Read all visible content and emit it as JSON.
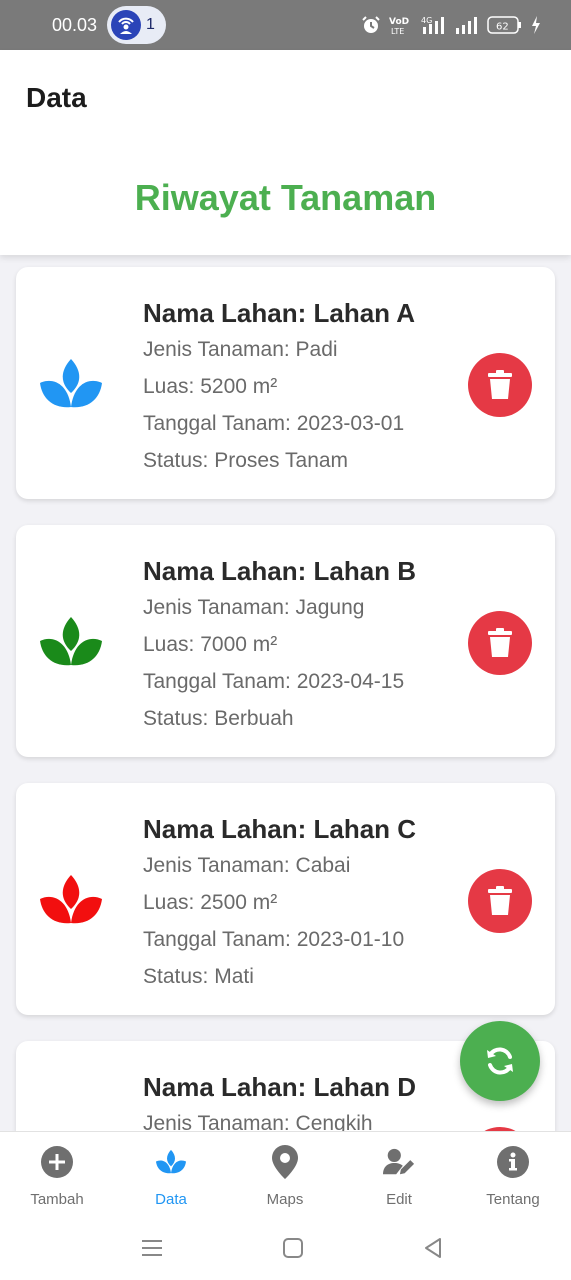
{
  "status_bar": {
    "time": "00.03",
    "notification_count": "1",
    "network_label": "4G",
    "volte_label": "VoLTE",
    "battery": "62"
  },
  "header": {
    "app_title": "Data",
    "page_heading": "Riwayat Tanaman"
  },
  "colors": {
    "accent_green": "#4caf50",
    "delete_red": "#e53945",
    "active_blue": "#2196f3"
  },
  "records": [
    {
      "name": "Nama Lahan: Lahan A",
      "crop": "Jenis Tanaman: Padi",
      "area": "Luas: 5200 m²",
      "date": "Tanggal Tanam: 2023-03-01",
      "status": "Status: Proses Tanam",
      "icon_color": "#2196f3",
      "icon": "lotus-icon"
    },
    {
      "name": "Nama Lahan: Lahan B",
      "crop": "Jenis Tanaman: Jagung",
      "area": "Luas: 7000 m²",
      "date": "Tanggal Tanam: 2023-04-15",
      "status": "Status: Berbuah",
      "icon_color": "#1a8a1a",
      "icon": "lotus-icon"
    },
    {
      "name": "Nama Lahan: Lahan C",
      "crop": "Jenis Tanaman: Cabai",
      "area": "Luas: 2500 m²",
      "date": "Tanggal Tanam: 2023-01-10",
      "status": "Status: Mati",
      "icon_color": "#f20f0f",
      "icon": "lotus-icon"
    },
    {
      "name": "Nama Lahan: Lahan D",
      "crop": "Jenis Tanaman: Cengkih",
      "area": "",
      "date": "",
      "status": "",
      "icon_color": "#1a8a1a",
      "icon": "lotus-icon"
    }
  ],
  "bottom_nav": [
    {
      "label": "Tambah",
      "icon": "plus-circle-icon"
    },
    {
      "label": "Data",
      "icon": "lotus-icon",
      "active": true
    },
    {
      "label": "Maps",
      "icon": "map-pin-icon"
    },
    {
      "label": "Edit",
      "icon": "user-edit-icon"
    },
    {
      "label": "Tentang",
      "icon": "info-icon"
    }
  ]
}
